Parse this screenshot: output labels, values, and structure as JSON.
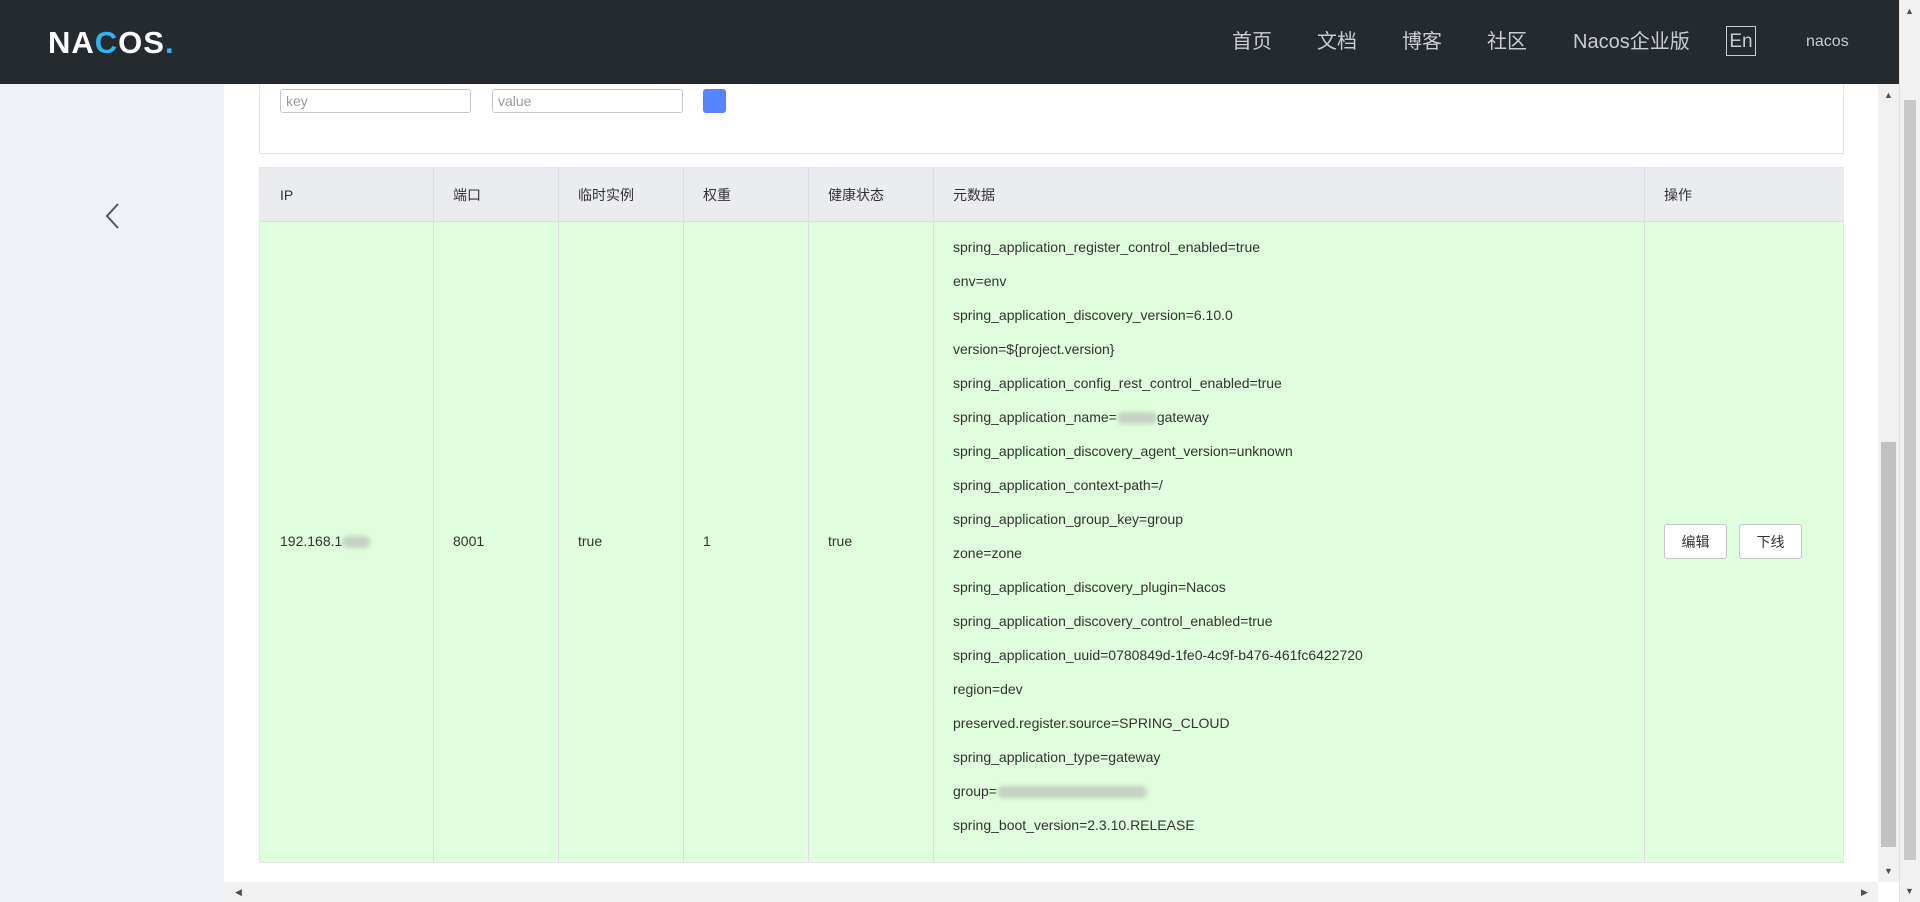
{
  "header": {
    "logo_text": "NACOS",
    "nav": [
      "首页",
      "文档",
      "博客",
      "社区",
      "Nacos企业版"
    ],
    "lang_button": "En",
    "user": "nacos"
  },
  "filter": {
    "key_placeholder": "key",
    "value_placeholder": "value"
  },
  "table": {
    "columns": [
      "IP",
      "端口",
      "临时实例",
      "权重",
      "健康状态",
      "元数据",
      "操作"
    ],
    "row": {
      "ip": "192.168.1",
      "port": "8001",
      "ephemeral": "true",
      "weight": "1",
      "healthy": "true",
      "metadata": [
        "spring_application_register_control_enabled=true",
        "env=env",
        "spring_application_discovery_version=6.10.0",
        "version=${project.version}",
        "spring_application_config_rest_control_enabled=true",
        "spring_application_name=",
        "spring_application_discovery_agent_version=unknown",
        "spring_application_context-path=/",
        "spring_application_group_key=group",
        "zone=zone",
        "spring_application_discovery_plugin=Nacos",
        "spring_application_discovery_control_enabled=true",
        "spring_application_uuid=0780849d-1fe0-4c9f-b476-461fc6422720",
        "region=dev",
        "preserved.register.source=SPRING_CLOUD",
        "spring_application_type=gateway",
        "group=",
        "spring_boot_version=2.3.10.RELEASE"
      ],
      "name_suffix": "gateway",
      "actions": [
        "编辑",
        "下线"
      ]
    }
  }
}
